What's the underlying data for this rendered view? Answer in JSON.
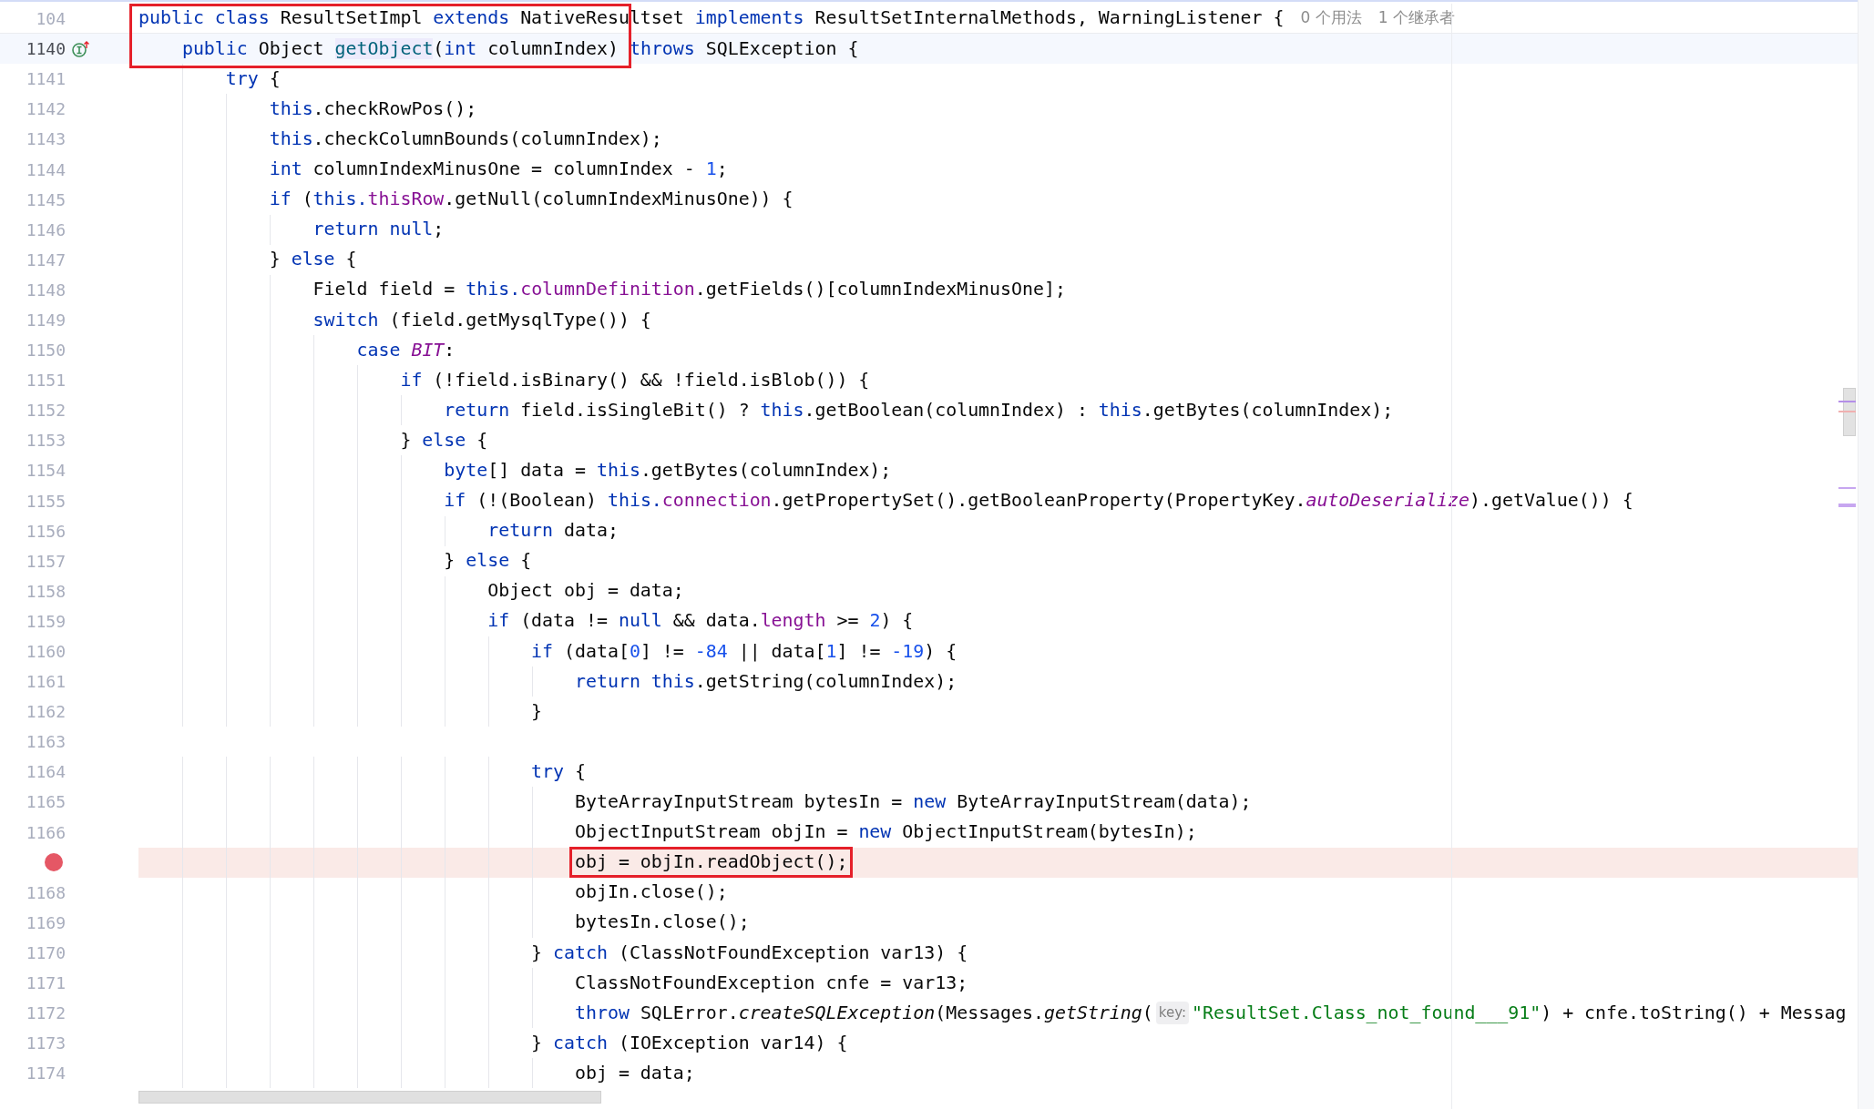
{
  "editor": {
    "lines": [
      {
        "number": "104",
        "breakpoint": false,
        "current": false,
        "tokens": [
          {
            "text": "public class",
            "kind": "keyword"
          },
          {
            "text": " ResultSetImpl ",
            "kind": "plain"
          },
          {
            "text": "extends",
            "kind": "keyword"
          },
          {
            "text": " NativeResultset ",
            "kind": "plain"
          },
          {
            "text": "implements",
            "kind": "keyword"
          },
          {
            "text": " ResultSetInternalMethods, WarningListener {",
            "kind": "plain"
          },
          {
            "text": "0 个用法",
            "kind": "usage"
          },
          {
            "text": "1 个继承者",
            "kind": "usage"
          }
        ]
      },
      {
        "number": "1140",
        "breakpoint": false,
        "current": true,
        "kind": "implementing",
        "tokens": [
          {
            "text": "    public",
            "kind": "keyword"
          },
          {
            "text": " Object ",
            "kind": "plain"
          },
          {
            "text": "getObject",
            "kind": "declaration"
          },
          {
            "text": "(",
            "kind": "plain"
          },
          {
            "text": "int",
            "kind": "keyword"
          },
          {
            "text": " columnIndex) ",
            "kind": "plain"
          },
          {
            "text": "throws",
            "kind": "keyword"
          },
          {
            "text": " SQLException {",
            "kind": "plain"
          }
        ]
      },
      {
        "number": "1141",
        "breakpoint": false,
        "current": false,
        "tokens": [
          {
            "text": "        try",
            "kind": "keyword"
          },
          {
            "text": " {",
            "kind": "plain"
          }
        ]
      },
      {
        "number": "1142",
        "breakpoint": false,
        "current": false,
        "tokens": [
          {
            "text": "            this",
            "kind": "keyword"
          },
          {
            "text": ".checkRowPos();",
            "kind": "plain"
          }
        ]
      },
      {
        "number": "1143",
        "breakpoint": false,
        "current": false,
        "tokens": [
          {
            "text": "            this",
            "kind": "keyword"
          },
          {
            "text": ".checkColumnBounds(columnIndex);",
            "kind": "plain"
          }
        ]
      },
      {
        "number": "1144",
        "breakpoint": false,
        "current": false,
        "tokens": [
          {
            "text": "            int",
            "kind": "keyword"
          },
          {
            "text": " columnIndexMinusOne = columnIndex - ",
            "kind": "plain"
          },
          {
            "text": "1",
            "kind": "number"
          },
          {
            "text": ";",
            "kind": "plain"
          }
        ]
      },
      {
        "number": "1145",
        "breakpoint": false,
        "current": false,
        "tokens": [
          {
            "text": "            if",
            "kind": "keyword"
          },
          {
            "text": " (",
            "kind": "plain"
          },
          {
            "text": "this.",
            "kind": "keyword"
          },
          {
            "text": "thisRow",
            "kind": "field"
          },
          {
            "text": ".getNull(columnIndexMinusOne)) {",
            "kind": "plain"
          }
        ]
      },
      {
        "number": "1146",
        "breakpoint": false,
        "current": false,
        "tokens": [
          {
            "text": "                return null",
            "kind": "keyword"
          },
          {
            "text": ";",
            "kind": "plain"
          }
        ]
      },
      {
        "number": "1147",
        "breakpoint": false,
        "current": false,
        "tokens": [
          {
            "text": "            } ",
            "kind": "plain"
          },
          {
            "text": "else",
            "kind": "keyword"
          },
          {
            "text": " {",
            "kind": "plain"
          }
        ]
      },
      {
        "number": "1148",
        "breakpoint": false,
        "current": false,
        "tokens": [
          {
            "text": "                Field field = ",
            "kind": "plain"
          },
          {
            "text": "this.",
            "kind": "keyword"
          },
          {
            "text": "columnDefinition",
            "kind": "field"
          },
          {
            "text": ".getFields()[columnIndexMinusOne];",
            "kind": "plain"
          }
        ]
      },
      {
        "number": "1149",
        "breakpoint": false,
        "current": false,
        "tokens": [
          {
            "text": "                switch",
            "kind": "keyword"
          },
          {
            "text": " (field.getMysqlType()) {",
            "kind": "plain"
          }
        ]
      },
      {
        "number": "1150",
        "breakpoint": false,
        "current": false,
        "tokens": [
          {
            "text": "                    case ",
            "kind": "keyword"
          },
          {
            "text": "BIT",
            "kind": "static-field"
          },
          {
            "text": ":",
            "kind": "plain"
          }
        ]
      },
      {
        "number": "1151",
        "breakpoint": false,
        "current": false,
        "tokens": [
          {
            "text": "                        if",
            "kind": "keyword"
          },
          {
            "text": " (!field.isBinary() && !field.isBlob()) {",
            "kind": "plain"
          }
        ]
      },
      {
        "number": "1152",
        "breakpoint": false,
        "current": false,
        "tokens": [
          {
            "text": "                            return",
            "kind": "keyword"
          },
          {
            "text": " field.isSingleBit() ? ",
            "kind": "plain"
          },
          {
            "text": "this",
            "kind": "keyword"
          },
          {
            "text": ".getBoolean(columnIndex) : ",
            "kind": "plain"
          },
          {
            "text": "this",
            "kind": "keyword"
          },
          {
            "text": ".getBytes(columnIndex);",
            "kind": "plain"
          }
        ]
      },
      {
        "number": "1153",
        "breakpoint": false,
        "current": false,
        "tokens": [
          {
            "text": "                        } ",
            "kind": "plain"
          },
          {
            "text": "else",
            "kind": "keyword"
          },
          {
            "text": " {",
            "kind": "plain"
          }
        ]
      },
      {
        "number": "1154",
        "breakpoint": false,
        "current": false,
        "tokens": [
          {
            "text": "                            byte",
            "kind": "keyword"
          },
          {
            "text": "[] data = ",
            "kind": "plain"
          },
          {
            "text": "this",
            "kind": "keyword"
          },
          {
            "text": ".getBytes(columnIndex);",
            "kind": "plain"
          }
        ]
      },
      {
        "number": "1155",
        "breakpoint": false,
        "current": false,
        "tokens": [
          {
            "text": "                            if",
            "kind": "keyword"
          },
          {
            "text": " (!(Boolean) ",
            "kind": "plain"
          },
          {
            "text": "this.",
            "kind": "keyword"
          },
          {
            "text": "connection",
            "kind": "field"
          },
          {
            "text": ".getPropertySet().getBooleanProperty(PropertyKey.",
            "kind": "plain"
          },
          {
            "text": "autoDeserialize",
            "kind": "static-field"
          },
          {
            "text": ").getValue()) {",
            "kind": "plain"
          }
        ]
      },
      {
        "number": "1156",
        "breakpoint": false,
        "current": false,
        "tokens": [
          {
            "text": "                                return",
            "kind": "keyword"
          },
          {
            "text": " data;",
            "kind": "plain"
          }
        ]
      },
      {
        "number": "1157",
        "breakpoint": false,
        "current": false,
        "tokens": [
          {
            "text": "                            } ",
            "kind": "plain"
          },
          {
            "text": "else",
            "kind": "keyword"
          },
          {
            "text": " {",
            "kind": "plain"
          }
        ]
      },
      {
        "number": "1158",
        "breakpoint": false,
        "current": false,
        "tokens": [
          {
            "text": "                                Object obj = data;",
            "kind": "plain"
          }
        ]
      },
      {
        "number": "1159",
        "breakpoint": false,
        "current": false,
        "tokens": [
          {
            "text": "                                if",
            "kind": "keyword"
          },
          {
            "text": " (data != ",
            "kind": "plain"
          },
          {
            "text": "null",
            "kind": "keyword"
          },
          {
            "text": " && data.",
            "kind": "plain"
          },
          {
            "text": "length",
            "kind": "field"
          },
          {
            "text": " >= ",
            "kind": "plain"
          },
          {
            "text": "2",
            "kind": "number"
          },
          {
            "text": ") {",
            "kind": "plain"
          }
        ]
      },
      {
        "number": "1160",
        "breakpoint": false,
        "current": false,
        "tokens": [
          {
            "text": "                                    if",
            "kind": "keyword"
          },
          {
            "text": " (data[",
            "kind": "plain"
          },
          {
            "text": "0",
            "kind": "number"
          },
          {
            "text": "] != ",
            "kind": "plain"
          },
          {
            "text": "-84",
            "kind": "number"
          },
          {
            "text": " || data[",
            "kind": "plain"
          },
          {
            "text": "1",
            "kind": "number"
          },
          {
            "text": "] != ",
            "kind": "plain"
          },
          {
            "text": "-19",
            "kind": "number"
          },
          {
            "text": ") {",
            "kind": "plain"
          }
        ]
      },
      {
        "number": "1161",
        "breakpoint": false,
        "current": false,
        "tokens": [
          {
            "text": "                                        return this",
            "kind": "keyword"
          },
          {
            "text": ".getString(columnIndex);",
            "kind": "plain"
          }
        ]
      },
      {
        "number": "1162",
        "breakpoint": false,
        "current": false,
        "tokens": [
          {
            "text": "                                    }",
            "kind": "plain"
          }
        ]
      },
      {
        "number": "1163",
        "breakpoint": false,
        "current": false
      },
      {
        "number": "1164",
        "breakpoint": false,
        "current": false,
        "tokens": [
          {
            "text": "                                    try",
            "kind": "keyword"
          },
          {
            "text": " {",
            "kind": "plain"
          }
        ]
      },
      {
        "number": "1165",
        "breakpoint": false,
        "current": false,
        "tokens": [
          {
            "text": "                                        ByteArrayInputStream bytesIn = ",
            "kind": "plain"
          },
          {
            "text": "new",
            "kind": "keyword"
          },
          {
            "text": " ByteArrayInputStream(data);",
            "kind": "plain"
          }
        ]
      },
      {
        "number": "1166",
        "breakpoint": false,
        "current": false,
        "tokens": [
          {
            "text": "                                        ObjectInputStream objIn = ",
            "kind": "plain"
          },
          {
            "text": "new",
            "kind": "keyword"
          },
          {
            "text": " ObjectInputStream(bytesIn);",
            "kind": "plain"
          }
        ]
      },
      {
        "breakpoint": true,
        "current": false,
        "boxed": true,
        "tokens": [
          {
            "text": "                                        obj = objIn.readObject();",
            "kind": "plain"
          }
        ]
      },
      {
        "number": "1168",
        "breakpoint": false,
        "current": false,
        "tokens": [
          {
            "text": "                                        objIn.close();",
            "kind": "plain"
          }
        ]
      },
      {
        "number": "1169",
        "breakpoint": false,
        "current": false,
        "tokens": [
          {
            "text": "                                        bytesIn.close();",
            "kind": "plain"
          }
        ]
      },
      {
        "number": "1170",
        "breakpoint": false,
        "current": false,
        "tokens": [
          {
            "text": "                                    } ",
            "kind": "plain"
          },
          {
            "text": "catch",
            "kind": "keyword"
          },
          {
            "text": " (ClassNotFoundException var13) {",
            "kind": "plain"
          }
        ]
      },
      {
        "number": "1171",
        "breakpoint": false,
        "current": false,
        "tokens": [
          {
            "text": "                                        ClassNotFoundException cnfe = var13;",
            "kind": "plain"
          }
        ]
      },
      {
        "number": "1172",
        "breakpoint": false,
        "current": false,
        "tokens": [
          {
            "text": "                                        throw",
            "kind": "keyword"
          },
          {
            "text": " SQLError.",
            "kind": "plain"
          },
          {
            "text": "createSQLException",
            "kind": "static-method"
          },
          {
            "text": "(Messages.",
            "kind": "plain"
          },
          {
            "text": "getString",
            "kind": "static-method"
          },
          {
            "text": "(",
            "kind": "plain"
          },
          {
            "text": "key:",
            "kind": "hint"
          },
          {
            "text": "\"ResultSet.Class_not_found___91\"",
            "kind": "string"
          },
          {
            "text": ") + cnfe.toString() + Messag",
            "kind": "plain"
          }
        ]
      },
      {
        "number": "1173",
        "breakpoint": false,
        "current": false,
        "tokens": [
          {
            "text": "                                    } ",
            "kind": "plain"
          },
          {
            "text": "catch",
            "kind": "keyword"
          },
          {
            "text": " (IOException var14) {",
            "kind": "plain"
          }
        ]
      },
      {
        "number": "1174",
        "breakpoint": false,
        "current": false,
        "tokens": [
          {
            "text": "                                        obj = data;",
            "kind": "plain"
          }
        ]
      }
    ]
  }
}
